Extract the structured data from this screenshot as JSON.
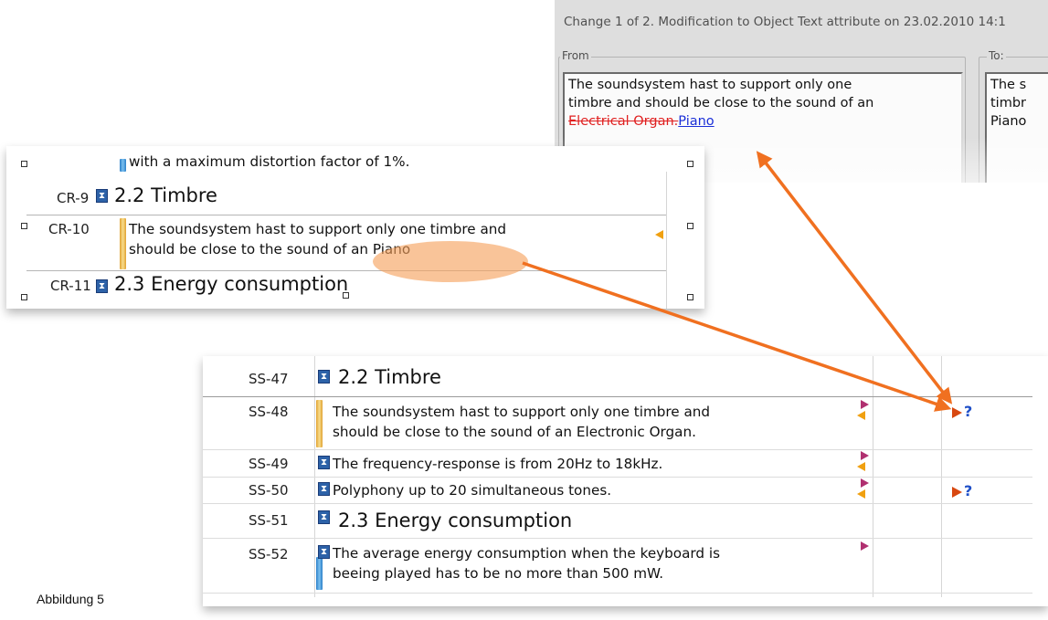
{
  "dialog": {
    "title": "Change 1 of 2. Modification to Object Text attribute on 23.02.2010 14:1",
    "from_label": "From",
    "to_label": "To:",
    "from_text_line1": "The soundsystem hast to support only one",
    "from_text_line2": "timbre  and should be close to the sound of an",
    "from_deleted": "Electrical Organ.",
    "from_inserted": "Piano",
    "to_text_line1": "The s",
    "to_text_line2": "timbr",
    "to_text_line3": "Piano"
  },
  "top_panel": {
    "partial_text": "with a maximum distortion factor of 1%.",
    "rows": [
      {
        "id": "CR-9",
        "heading": "2.2 Timbre"
      },
      {
        "id": "CR-10",
        "text_line1": "The soundsystem hast to support only one timbre  and",
        "text_line2": "should be close to the sound of an Piano"
      },
      {
        "id": "CR-11",
        "heading": "2.3 Energy consumption"
      }
    ]
  },
  "bottom_panel": {
    "rows": [
      {
        "id": "SS-47",
        "heading": "2.2 Timbre"
      },
      {
        "id": "SS-48",
        "text_line1": "The soundsystem hast to support only one timbre  and",
        "text_line2": "should be close to the sound of an Electronic Organ.",
        "suspect": "?"
      },
      {
        "id": "SS-49",
        "text": "The frequency-response is from 20Hz to 18kHz."
      },
      {
        "id": "SS-50",
        "text": "Polyphony up to 20 simultaneous tones.",
        "suspect": "?"
      },
      {
        "id": "SS-51",
        "heading": "2.3 Energy consumption"
      },
      {
        "id": "SS-52",
        "text_line1": "The average energy consumption when the keyboard is",
        "text_line2": "beeing played has to be no more than 500 mW."
      }
    ]
  },
  "caption": "Abbildung 5",
  "colors": {
    "arrow": "#f07020",
    "highlight": "#f5a05a",
    "deleted": "#e02020",
    "inserted": "#1b2fd8"
  },
  "icons": {
    "object_marker": "hourglass-icon",
    "in_link": "left-triangle-icon",
    "out_link": "right-triangle-icon"
  }
}
